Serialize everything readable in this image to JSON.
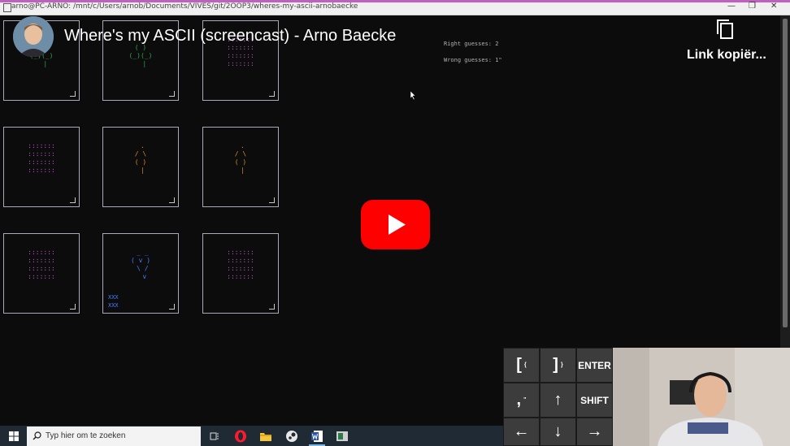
{
  "window": {
    "title": "arno@PC-ARNO: /mnt/c/Users/arnob/Documents/VIVES/git/2OOP3/wheres-my-ascii-arnobaecke",
    "minimize_glyph": "—",
    "maximize_glyph": "❐",
    "close_glyph": "✕"
  },
  "video": {
    "title": "Where's my ASCII (screencast) - Arno Baecke",
    "copy_link_label": "Link kopiër..."
  },
  "game": {
    "right_guesses": "Right guesses: 2",
    "wrong_guesses": "Wrong guesses: 1\"",
    "cards": [
      {
        "art": " _\n( )\n(_)(_)\n  |",
        "color": "#2fa84f",
        "marker": ""
      },
      {
        "art": " _\n( )\n(_)(_)\n  |",
        "color": "#2fa84f",
        "marker": ""
      },
      {
        "art": ":::::::\n:::::::\n:::::::\n:::::::",
        "color": "#c050d0",
        "marker": ""
      },
      {
        "art": ":::::::\n:::::::\n:::::::\n:::::::",
        "color": "#c050d0",
        "marker": ""
      },
      {
        "art": " .\n/ \\\n( )\n |",
        "color": "#d98a2a",
        "marker": ""
      },
      {
        "art": " .\n/ \\\n( )\n |",
        "color": "#d98a2a",
        "marker": ""
      },
      {
        "art": ":::::::\n:::::::\n:::::::\n:::::::",
        "color": "#c050d0",
        "marker": ""
      },
      {
        "art": " _ _\n( v )\n \\ /\n  v",
        "color": "#4a7cff",
        "marker": "XXX\nXXX"
      },
      {
        "art": ":::::::\n:::::::\n:::::::\n:::::::",
        "color": "#c050d0",
        "marker": ""
      }
    ]
  },
  "keypad": {
    "keys": [
      {
        "main": "[",
        "sub": "{"
      },
      {
        "main": "]",
        "sub": "}"
      },
      {
        "main": "ENTER",
        "sub": ""
      },
      {
        "main": ",",
        "sub": "\""
      },
      {
        "main": "↑",
        "sub": ""
      },
      {
        "main": "SHIFT",
        "sub": ""
      },
      {
        "main": "←",
        "sub": ""
      },
      {
        "main": "↓",
        "sub": ""
      },
      {
        "main": "→",
        "sub": ""
      }
    ]
  },
  "taskbar": {
    "search_placeholder": "Typ hier om te zoeken",
    "icons": [
      "windows-start-icon",
      "task-view-icon",
      "opera-icon",
      "file-explorer-icon",
      "steam-icon",
      "word-icon",
      "app-icon"
    ]
  }
}
